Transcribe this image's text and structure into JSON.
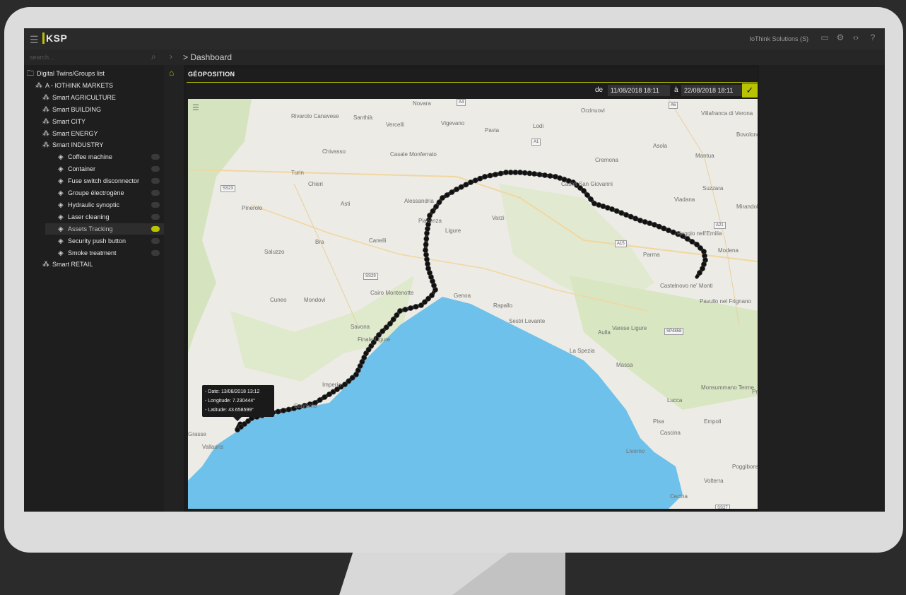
{
  "app": {
    "logo": "KSP",
    "company": "IoThink Solutions (S)",
    "search_placeholder": "search...",
    "breadcrumb": "> Dashboard"
  },
  "sidebar": {
    "items": [
      {
        "label": "Digital Twins/Groups list",
        "level": 0,
        "icon": "folder-icon"
      },
      {
        "label": "A - IOTHINK MARKETS",
        "level": 1,
        "icon": "group-icon"
      },
      {
        "label": "Smart AGRICULTURE",
        "level": 2,
        "icon": "group-icon"
      },
      {
        "label": "Smart BUILDING",
        "level": 2,
        "icon": "group-icon"
      },
      {
        "label": "Smart CITY",
        "level": 2,
        "icon": "group-icon"
      },
      {
        "label": "Smart ENERGY",
        "level": 2,
        "icon": "group-icon"
      },
      {
        "label": "Smart INDUSTRY",
        "level": 2,
        "icon": "group-icon"
      },
      {
        "label": "Coffee machine",
        "level": 3,
        "icon": "cube-icon"
      },
      {
        "label": "Container",
        "level": 3,
        "icon": "cube-icon"
      },
      {
        "label": "Fuse switch disconnector",
        "level": 3,
        "icon": "cube-icon"
      },
      {
        "label": "Groupe électrogène",
        "level": 3,
        "icon": "cube-icon"
      },
      {
        "label": "Hydraulic synoptic",
        "level": 3,
        "icon": "cube-icon"
      },
      {
        "label": "Laser cleaning",
        "level": 3,
        "icon": "cube-icon"
      },
      {
        "label": "Assets Tracking",
        "level": 3,
        "icon": "cube-icon",
        "selected": true
      },
      {
        "label": "Security push button",
        "level": 3,
        "icon": "cube-icon"
      },
      {
        "label": "Smoke treatment",
        "level": 3,
        "icon": "cube-icon"
      },
      {
        "label": "Smart RETAIL",
        "level": 2,
        "icon": "group-icon"
      }
    ]
  },
  "panel": {
    "title": "GÉOPOSITION",
    "date_from_label": "de",
    "date_from": "11/08/2018 18:11",
    "date_to_label": "à",
    "date_to": "22/08/2018 18:11"
  },
  "map": {
    "tooltip": [
      "- Date: 13/08/2018 13:12",
      "- Longitude: 7.230444°",
      "- Latitude: 43.658599°"
    ],
    "places": [
      "Novara",
      "Santhià",
      "Vercelli",
      "Vigevano",
      "Lodi",
      "Orzinuovi",
      "Villafranca di Verona",
      "Rivarolo Canavese",
      "Casale Monferrato",
      "Pavia",
      "Chivasso",
      "Turin",
      "Chieri",
      "Cremona",
      "Asola",
      "Mantua",
      "Bovolone",
      "Alessandria",
      "Asti",
      "Piacenza",
      "Castel San Giovanni",
      "Suzzara",
      "Viadana",
      "Mirandola",
      "Pinerolo",
      "Varzi",
      "Ligure",
      "Bra",
      "Canelli",
      "Reggio nell'Emilia",
      "Modena",
      "Saluzzo",
      "Parma",
      "Cuneo",
      "Cairo Montenotte",
      "Mondovì",
      "Genoa",
      "Rapallo",
      "Sestri Levante",
      "Castelnovo ne' Monti",
      "Pavullo nel Frignano",
      "Aulla",
      "La Spezia",
      "Massa",
      "Finale Ligure",
      "Monsummano Terme",
      "Lucca",
      "Prato",
      "Pisa",
      "Cascina",
      "Empoli",
      "Livorno",
      "Grasse",
      "Vallauris",
      "Volterra",
      "Poggibonsi",
      "Cecina",
      "Savona",
      "Imperia",
      "Sanremo",
      "Varese Ligure"
    ],
    "shields": [
      "A4",
      "A1",
      "SS23",
      "A6",
      "SS29",
      "A15",
      "A21",
      "SP4858",
      "SS27"
    ],
    "colors": {
      "sea": "#6ec1ea",
      "land": "#ecebe5",
      "hills": "#d7e7c2",
      "track": "#111111",
      "accent": "#b8c400"
    }
  }
}
